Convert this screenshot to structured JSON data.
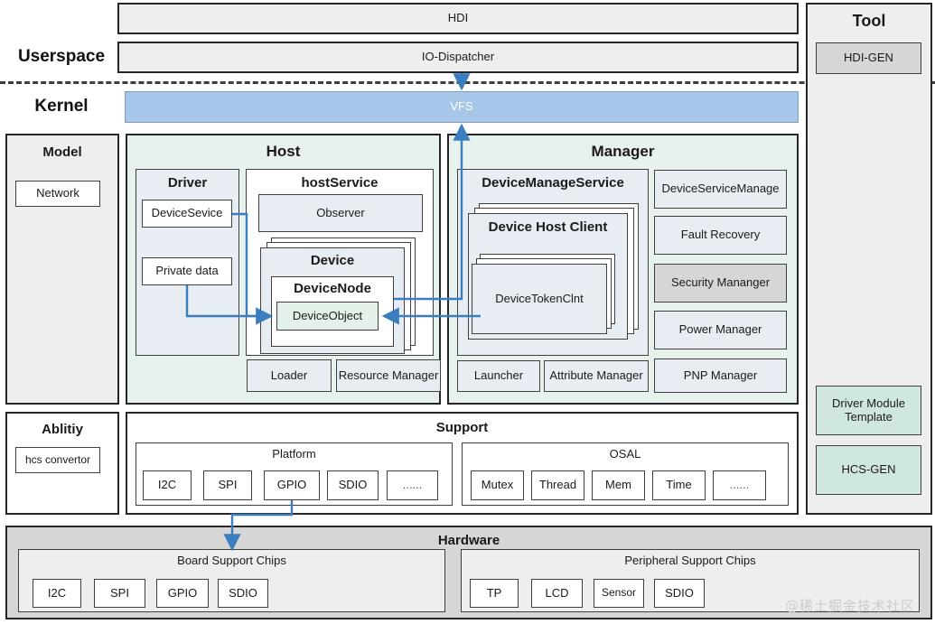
{
  "layers": {
    "userspace_label": "Userspace",
    "kernel_label": "Kernel"
  },
  "top_bars": {
    "hdi": "HDI",
    "io_dispatcher": "IO-Dispatcher",
    "vfs": "VFS"
  },
  "model": {
    "title": "Model",
    "items": [
      "Network"
    ]
  },
  "ability": {
    "title": "Ablitiy",
    "items": [
      "hcs convertor"
    ]
  },
  "host": {
    "title": "Host",
    "driver": {
      "title": "Driver",
      "items": [
        "DeviceSevice",
        "Private data"
      ]
    },
    "host_service": {
      "title": "hostService",
      "observer": "Observer",
      "device": {
        "title": "Device",
        "device_node": "DeviceNode",
        "device_object": "DeviceObject"
      }
    },
    "bottom_items": [
      "Loader",
      "Resource Manager"
    ]
  },
  "manager": {
    "title": "Manager",
    "device_manage_service": {
      "title": "DeviceManageService",
      "device_host_client": {
        "title": "Device Host Client",
        "device_token_clnt": "DeviceTokenClnt"
      }
    },
    "right_items": [
      {
        "label": "DeviceServiceManage",
        "highlight": false
      },
      {
        "label": "Fault Recovery",
        "highlight": false
      },
      {
        "label": "Security Mananger",
        "highlight": true
      },
      {
        "label": "Power Manager",
        "highlight": false
      },
      {
        "label": "PNP Manager",
        "highlight": false
      }
    ],
    "bottom_items": [
      "Launcher",
      "Attribute Manager"
    ]
  },
  "support": {
    "title": "Support",
    "platform": {
      "title": "Platform",
      "items": [
        "I2C",
        "SPI",
        "GPIO",
        "SDIO",
        "......"
      ]
    },
    "osal": {
      "title": "OSAL",
      "items": [
        "Mutex",
        "Thread",
        "Mem",
        "Time",
        "......"
      ]
    }
  },
  "tool": {
    "title": "Tool",
    "items": [
      {
        "label": "HDI-GEN",
        "style": "grey"
      },
      {
        "label": "Driver Module Template",
        "style": "green"
      },
      {
        "label": "HCS-GEN",
        "style": "green"
      }
    ]
  },
  "hardware": {
    "title": "Hardware",
    "board": {
      "title": "Board Support Chips",
      "items": [
        "I2C",
        "SPI",
        "GPIO",
        "SDIO"
      ]
    },
    "peripheral": {
      "title": "Peripheral Support Chips",
      "items": [
        "TP",
        "LCD",
        "Sensor",
        "SDIO"
      ]
    }
  },
  "watermark": "@稀土掘金技术社区",
  "colors": {
    "accent": "#3a7ebf",
    "vfs": "#a8c6e8",
    "green": "#e8f2ec",
    "grey": "#eeeeee"
  }
}
